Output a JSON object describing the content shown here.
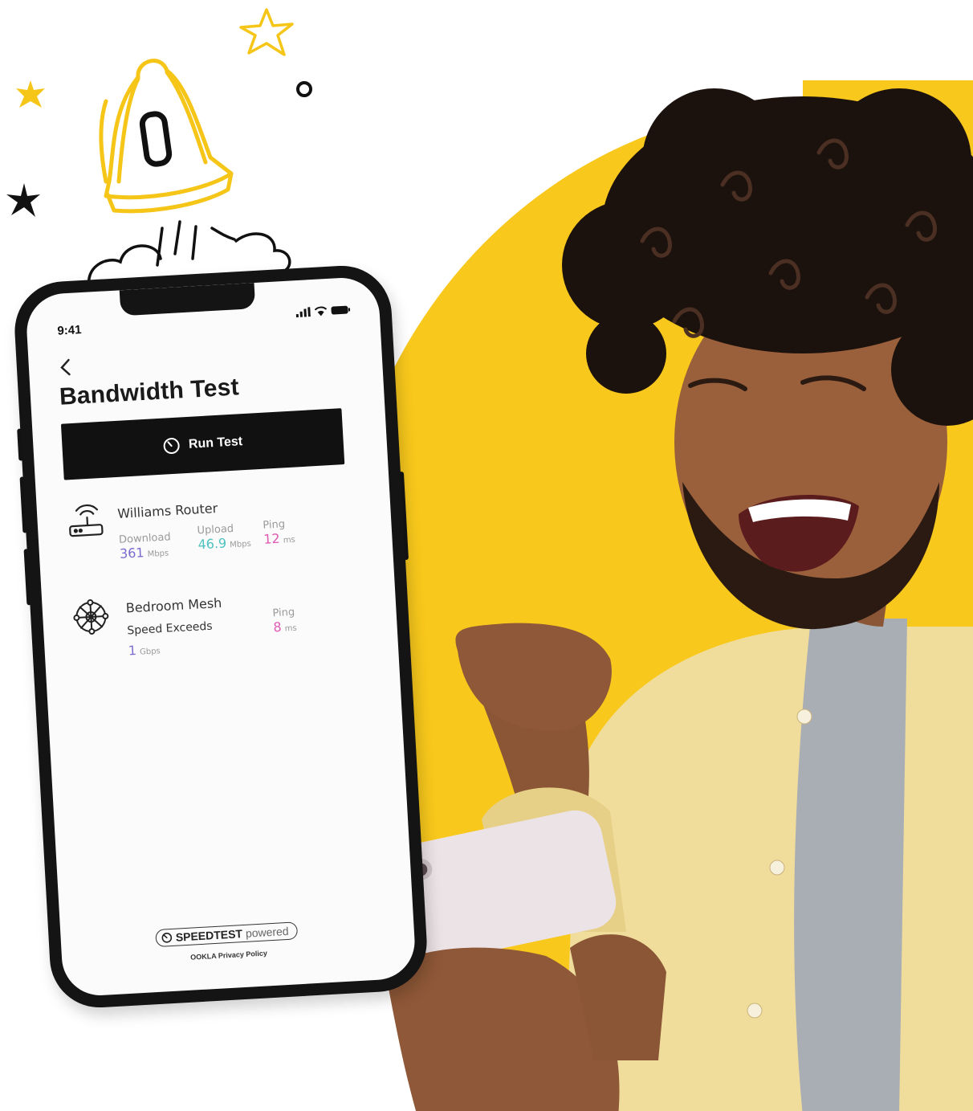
{
  "phone": {
    "time": "9:41",
    "title": "Bandwidth Test",
    "run_test_label": "Run Test",
    "devices": [
      {
        "name": "Williams Router",
        "icon": "router-icon",
        "download_label": "Download",
        "download_value": "361",
        "download_unit": "Mbps",
        "upload_label": "Upload",
        "upload_value": "46.9",
        "upload_unit": "Mbps",
        "ping_label": "Ping",
        "ping_value": "12",
        "ping_unit": "ms"
      },
      {
        "name": "Bedroom Mesh",
        "icon": "mesh-icon",
        "status": "Speed Exceeds",
        "speed_value": "1",
        "speed_unit": "Gbps",
        "ping_label": "Ping",
        "ping_value": "8",
        "ping_unit": "ms"
      }
    ],
    "footer_brand": "SPEEDTEST",
    "footer_powered": "powered",
    "footer_link": "OOKLA Privacy Policy"
  },
  "colors": {
    "accent_yellow": "#f8c81c",
    "download": "#7d6bd0",
    "upload": "#4ec2c0",
    "ping": "#e05ab4"
  }
}
